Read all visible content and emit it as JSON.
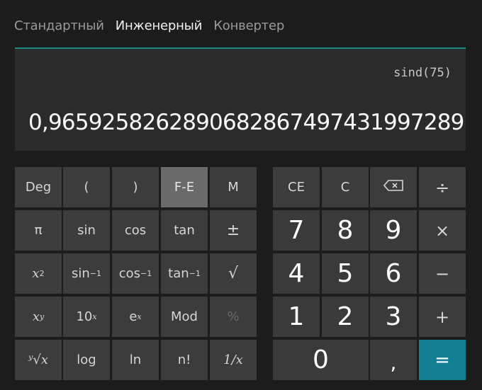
{
  "tabs": [
    {
      "label": "Стандартный",
      "active": false
    },
    {
      "label": "Инженерный",
      "active": true
    },
    {
      "label": "Конвертер",
      "active": false
    }
  ],
  "display": {
    "expression": "sind(75)",
    "result": "0,9659258262890682867497431997289"
  },
  "accent_color": "#1e8c7e",
  "equals_color": "#137f93",
  "scientific_keys": [
    [
      {
        "id": "deg",
        "label": "Deg"
      },
      {
        "id": "open-paren",
        "label": "("
      },
      {
        "id": "close-paren",
        "label": ")"
      },
      {
        "id": "fe",
        "label": "F-E",
        "state": "on"
      },
      {
        "id": "memory",
        "label": "M"
      }
    ],
    [
      {
        "id": "pi",
        "label": "π"
      },
      {
        "id": "sin",
        "label": "sin"
      },
      {
        "id": "cos",
        "label": "cos"
      },
      {
        "id": "tan",
        "label": "tan"
      },
      {
        "id": "negate",
        "label": "±"
      }
    ],
    [
      {
        "id": "square",
        "base": "x",
        "sup": "2"
      },
      {
        "id": "asin",
        "base": "sin",
        "sup": "−1"
      },
      {
        "id": "acos",
        "base": "cos",
        "sup": "−1"
      },
      {
        "id": "atan",
        "base": "tan",
        "sup": "−1"
      },
      {
        "id": "sqrt",
        "label": "√"
      }
    ],
    [
      {
        "id": "power",
        "base": "x",
        "sup": "y"
      },
      {
        "id": "pow10",
        "base": "10",
        "sup": "x"
      },
      {
        "id": "exp",
        "base": "e",
        "sup": "x"
      },
      {
        "id": "mod",
        "label": "Mod"
      },
      {
        "id": "percent",
        "label": "%",
        "state": "disabled"
      }
    ],
    [
      {
        "id": "yroot",
        "label": "∛x",
        "display": "ʸ√x"
      },
      {
        "id": "log",
        "label": "log"
      },
      {
        "id": "ln",
        "label": "ln"
      },
      {
        "id": "factorial",
        "label": "n!"
      },
      {
        "id": "reciprocal",
        "label": "1/x"
      }
    ]
  ],
  "keypad": {
    "ce": "CE",
    "c": "C",
    "backspace_icon": "backspace-icon",
    "divide": "÷",
    "d7": "7",
    "d8": "8",
    "d9": "9",
    "multiply": "×",
    "d4": "4",
    "d5": "5",
    "d6": "6",
    "minus": "−",
    "d1": "1",
    "d2": "2",
    "d3": "3",
    "plus": "+",
    "d0": "0",
    "decimal": ",",
    "equals": "="
  }
}
